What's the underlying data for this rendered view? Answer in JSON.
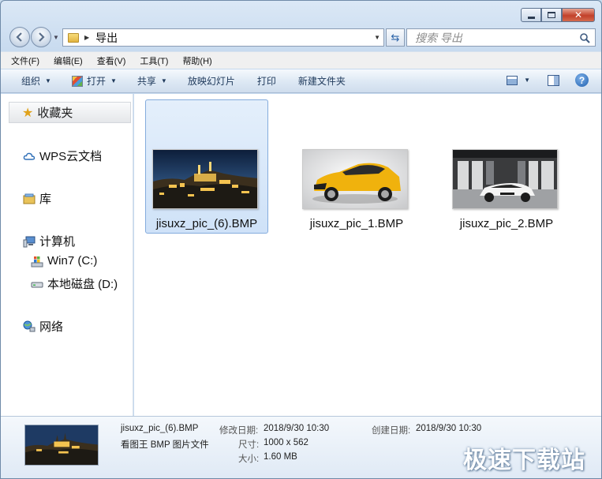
{
  "address": {
    "folder_name": "导出"
  },
  "search": {
    "placeholder": "搜索 导出"
  },
  "menu": [
    "文件(F)",
    "编辑(E)",
    "查看(V)",
    "工具(T)",
    "帮助(H)"
  ],
  "toolbar": {
    "organize": "组织",
    "open": "打开",
    "share": "共享",
    "slideshow": "放映幻灯片",
    "print": "打印",
    "new_folder": "新建文件夹"
  },
  "navpane": {
    "favorites": "收藏夹",
    "wps": "WPS云文档",
    "library": "库",
    "computer": "计算机",
    "drive_c": "Win7 (C:)",
    "drive_d": "本地磁盘 (D:)",
    "network": "网络"
  },
  "files": [
    {
      "name": "jisuxz_pic_(6).BMP",
      "selected": true
    },
    {
      "name": "jisuxz_pic_1.BMP",
      "selected": false
    },
    {
      "name": "jisuxz_pic_2.BMP",
      "selected": false
    }
  ],
  "details": {
    "file_name": "jisuxz_pic_(6).BMP",
    "file_type": "看图王 BMP 图片文件",
    "modified_label": "修改日期:",
    "modified_value": "2018/9/30 10:30",
    "created_label": "创建日期:",
    "created_value": "2018/9/30 10:30",
    "dimensions_label": "尺寸:",
    "dimensions_value": "1000 x 562",
    "size_label": "大小:",
    "size_value": "1.60 MB"
  },
  "watermark": "极速下载站",
  "caption": {
    "close_glyph": "✕"
  }
}
